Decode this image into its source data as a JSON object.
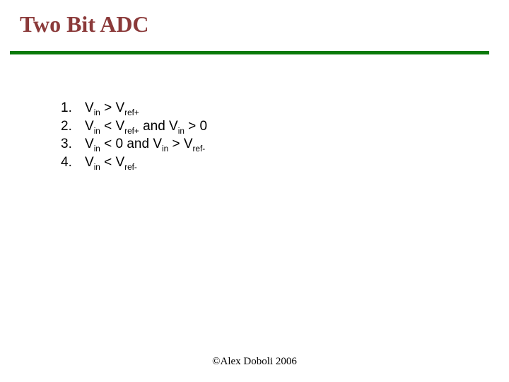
{
  "title": "Two Bit ADC",
  "list": {
    "items": [
      {
        "num": "1.",
        "parts": [
          "V",
          "in",
          " > V",
          "ref+",
          ""
        ]
      },
      {
        "num": "2.",
        "parts": [
          "V",
          "in",
          " < V",
          "ref+",
          " and V",
          "in",
          " > 0"
        ]
      },
      {
        "num": "3.",
        "parts": [
          "V",
          "in",
          " < 0 and V",
          "in",
          " > V",
          "ref-",
          ""
        ]
      },
      {
        "num": "4.",
        "parts": [
          "V",
          "in",
          " < V",
          "ref-",
          ""
        ]
      }
    ]
  },
  "footer": "©Alex Doboli 2006"
}
